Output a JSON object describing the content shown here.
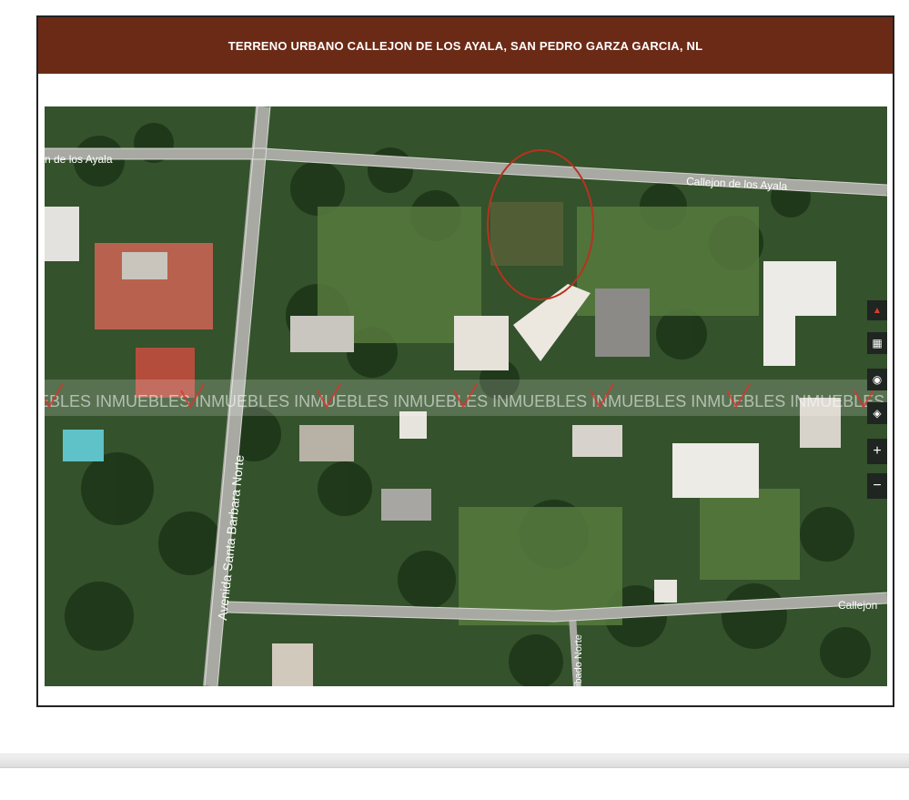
{
  "title": "TERRENO URBANO CALLEJON DE LOS AYALA, SAN PEDRO GARZA GARCIA, NL",
  "map": {
    "street_labels": {
      "top_left": "n de los Ayala",
      "top_right": "Callejon de los Ayala",
      "vertical_avenue": "Avenida Santa Barbara Norte",
      "bottom_right": "Callejon",
      "bottom_vertical": "ibado Norte"
    },
    "watermark": {
      "mark": "VIA",
      "text": "UEBLES INMUEBLES INMUEBLES INMUEBLES INMUEBLES INMUEBLES INMUEBLES INMUEBLES INMUEBLES INMUE"
    },
    "controls": {
      "compass_icon": "compass-icon",
      "grid_icon": "grid-icon",
      "locate_icon": "locate-icon",
      "layers_icon": "layers-icon",
      "zoom_in": "+",
      "zoom_out": "−"
    },
    "highlight_color": "#b8321f"
  }
}
